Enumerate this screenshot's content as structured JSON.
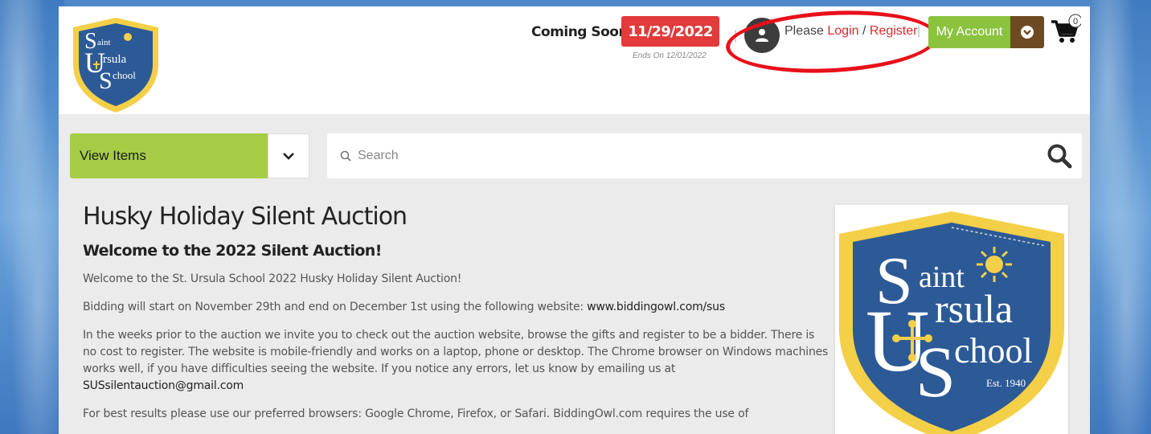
{
  "header": {
    "logo_alt": "Saint Ursula School logo",
    "coming_soon": "Coming Soon",
    "date_badge": "11/29/2022",
    "ends_on": "Ends On 12/01/2022",
    "please": "Please",
    "login_link": "Login",
    "slash": "/",
    "register_link": "Register",
    "my_account": "My Account",
    "cart_count": "0"
  },
  "toolbar": {
    "view_items": "View Items",
    "search_placeholder": "Search"
  },
  "main": {
    "title": "Husky Holiday Silent Auction",
    "subtitle": "Welcome to the 2022 Silent Auction!",
    "p1": "Welcome to the St. Ursula School 2022 Husky Holiday Silent Auction!",
    "p2_text": "Bidding will start on November 29th and end on December 1st using the following website: ",
    "p2_link": "www.biddingowl.com/sus",
    "p3_text": "In the weeks prior to the auction we invite you to check out the auction website, browse the gifts and register to be a bidder.  There is no cost to register.  The website is mobile-friendly and works on a laptop, phone or desktop.  The Chrome browser on Windows machines works well, if you have difficulties seeing the website.  If you notice any errors, let us know by emailing us at ",
    "p3_email": "SUSsilentauction@gmail.com",
    "p4": "For best results please use our preferred browsers: Google Chrome, Firefox, or Safari. BiddingOwl.com requires the use of"
  },
  "logo": {
    "saint": "aint",
    "ursula": "rsula",
    "school": "chool",
    "est": "Est. 1940"
  },
  "colors": {
    "date_badge": "#e33a3a",
    "my_account": "#8bc33f",
    "account_toggle": "#6e4a22",
    "view_items": "#a6cc46",
    "link_red": "#d42b2b",
    "annotation_oval": "#e8101a",
    "shield_blue": "#2c5a96",
    "shield_gold": "#f4cf48"
  }
}
